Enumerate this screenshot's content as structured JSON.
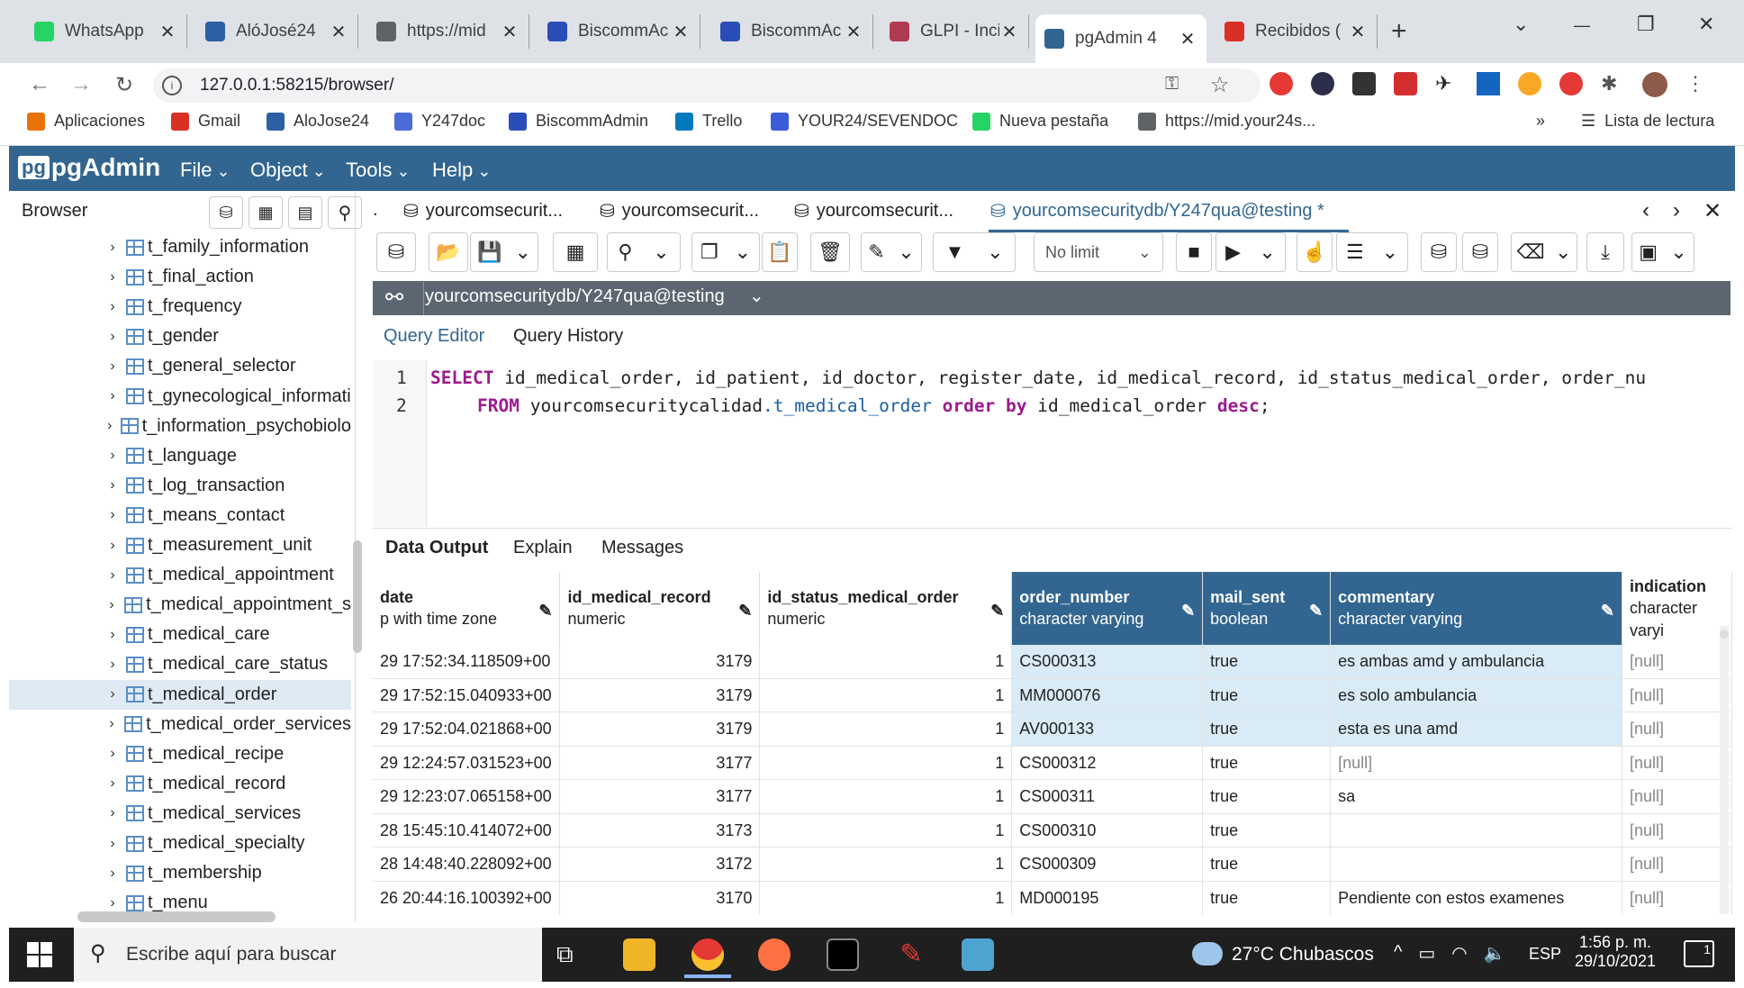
{
  "browser": {
    "tabs": [
      {
        "title": "WhatsApp",
        "color": "#25d366"
      },
      {
        "title": "AlóJosé24",
        "color": "#2d5fa3"
      },
      {
        "title": "https://mid",
        "color": "#5f6368"
      },
      {
        "title": "BiscommAc",
        "color": "#2a4db8"
      },
      {
        "title": "BiscommAc",
        "color": "#2a4db8"
      },
      {
        "title": "GLPI - Incid",
        "color": "#b03a52"
      },
      {
        "title": "pgAdmin 4",
        "color": "#326690"
      },
      {
        "title": "Recibidos (",
        "color": "#d93025"
      }
    ],
    "url": "127.0.0.1:58215/browser/",
    "bookmarks": [
      {
        "label": "Aplicaciones",
        "color": "#e8710a"
      },
      {
        "label": "Gmail",
        "color": "#d93025"
      },
      {
        "label": "AloJose24",
        "color": "#2d5fa3"
      },
      {
        "label": "Y247doc",
        "color": "#4a6cd4"
      },
      {
        "label": "BiscommAdmin",
        "color": "#2a4db8"
      },
      {
        "label": "Trello",
        "color": "#0079bf"
      },
      {
        "label": "YOUR24/SEVENDOC",
        "color": "#3b5bdb"
      },
      {
        "label": "Nueva pestaña",
        "color": "#25d366"
      },
      {
        "label": "https://mid.your24s...",
        "color": "#5f6368"
      }
    ],
    "reading_list": "Lista de lectura",
    "more": "»"
  },
  "pgadmin": {
    "logo": "pgAdmin",
    "menus": [
      "File",
      "Object",
      "Tools",
      "Help"
    ],
    "browser_title": "Browser",
    "tables": [
      "t_family_information",
      "t_final_action",
      "t_frequency",
      "t_gender",
      "t_general_selector",
      "t_gynecological_informati",
      "t_information_psychobiolo",
      "t_language",
      "t_log_transaction",
      "t_means_contact",
      "t_measurement_unit",
      "t_medical_appointment",
      "t_medical_appointment_s",
      "t_medical_care",
      "t_medical_care_status",
      "t_medical_order",
      "t_medical_order_services",
      "t_medical_recipe",
      "t_medical_record",
      "t_medical_services",
      "t_medical_specialty",
      "t_membership",
      "t_menu"
    ],
    "selected_table": "t_medical_order",
    "panel_tabs": [
      "yourcomsecurit...",
      "yourcomsecurit...",
      "yourcomsecurit...",
      "yourcomsecuritydb/Y247qua@testing *"
    ],
    "limit": "No limit",
    "connection": "yourcomsecuritydb/Y247qua@testing",
    "editor_tabs": [
      "Query Editor",
      "Query History"
    ],
    "sql": {
      "line1_kw": "SELECT",
      "line1_rest": " id_medical_order, id_patient, id_doctor, register_date, id_medical_record, id_status_medical_order, order_nu",
      "line2_kw": "FROM",
      "line2_schema": " yourcomsecuritycalidad",
      "line2_table": ".t_medical_order ",
      "line2_kw2": "order by",
      "line2_col": " id_medical_order ",
      "line2_kw3": "desc",
      "line2_end": ";"
    },
    "output_tabs": [
      "Data Output",
      "Explain",
      "Messages"
    ],
    "columns": [
      {
        "name": "date",
        "type": "p with time zone"
      },
      {
        "name": "id_medical_record",
        "type": "numeric"
      },
      {
        "name": "id_status_medical_order",
        "type": "numeric"
      },
      {
        "name": "order_number",
        "type": "character varying"
      },
      {
        "name": "mail_sent",
        "type": "boolean"
      },
      {
        "name": "commentary",
        "type": "character varying"
      },
      {
        "name": "indication",
        "type": "character varyi"
      }
    ],
    "rows": [
      [
        "29 17:52:34.118509+00",
        "3179",
        "1",
        "CS000313",
        "true",
        "es ambas amd y ambulancia",
        "[null]"
      ],
      [
        "29 17:52:15.040933+00",
        "3179",
        "1",
        "MM000076",
        "true",
        "es solo ambulancia",
        "[null]"
      ],
      [
        "29 17:52:04.021868+00",
        "3179",
        "1",
        "AV000133",
        "true",
        "esta es una amd",
        "[null]"
      ],
      [
        "29 12:24:57.031523+00",
        "3177",
        "1",
        "CS000312",
        "true",
        "[null]",
        "[null]"
      ],
      [
        "29 12:23:07.065158+00",
        "3177",
        "1",
        "CS000311",
        "true",
        "sa",
        "[null]"
      ],
      [
        "28 15:45:10.414072+00",
        "3173",
        "1",
        "CS000310",
        "true",
        "",
        "[null]"
      ],
      [
        "28 14:48:40.228092+00",
        "3172",
        "1",
        "CS000309",
        "true",
        "",
        "[null]"
      ],
      [
        "26 20:44:16.100392+00",
        "3170",
        "1",
        "MD000195",
        "true",
        "Pendiente con estos examenes",
        "[null]"
      ],
      [
        "",
        "",
        "",
        "",
        "",
        "",
        ""
      ]
    ]
  },
  "taskbar": {
    "search_placeholder": "Escribe aquí para buscar",
    "weather": "27°C  Chubascos",
    "lang": "ESP",
    "time": "1:56 p. m.",
    "date": "29/10/2021",
    "notifications": "1"
  }
}
